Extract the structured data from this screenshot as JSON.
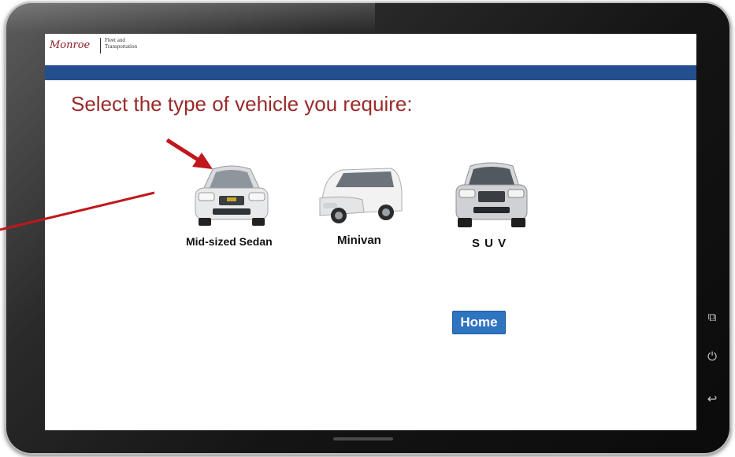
{
  "header": {
    "logo_text": "Monroe",
    "logo_sub_line1": "Fleet and",
    "logo_sub_line2": "Transportation",
    "bar_color": "#244f8e"
  },
  "main": {
    "prompt": "Select the type of vehicle you require:",
    "vehicles": [
      {
        "label": "Mid-sized Sedan",
        "icon": "sedan-icon"
      },
      {
        "label": "Minivan",
        "icon": "minivan-icon"
      },
      {
        "label": "S U V",
        "icon": "suv-icon"
      }
    ],
    "home_button": "Home"
  },
  "device": {
    "side_buttons": [
      "recent-apps-icon",
      "power-icon",
      "back-icon"
    ]
  },
  "colors": {
    "accent_text": "#9a2a2a",
    "button": "#2e74c0",
    "callout": "#c0171c"
  }
}
